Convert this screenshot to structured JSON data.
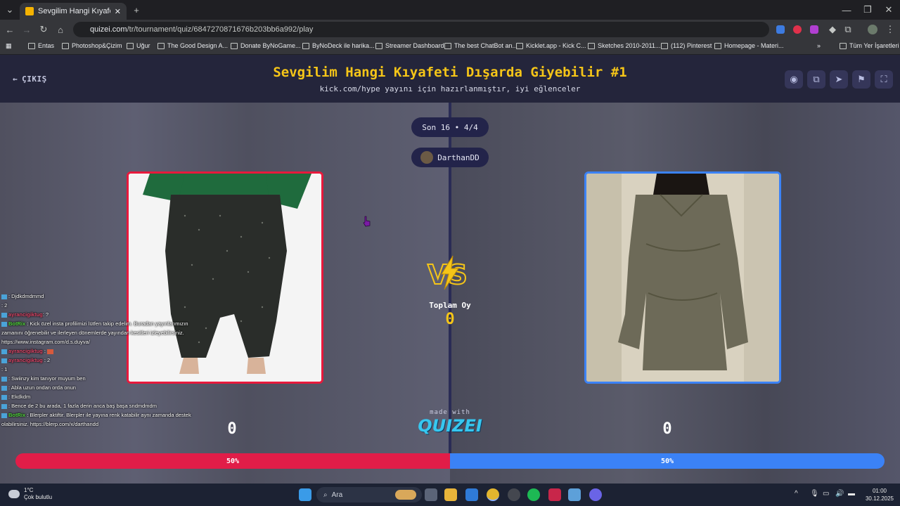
{
  "browser": {
    "tab_title": "Sevgilim Hangi Kıyafeti Dışarda",
    "url_host": "quizei.com",
    "url_path": "/tr/tournament/quiz/6847270871676b203bb6a992/play",
    "bookmarks": [
      "Entas",
      "Photoshop&Çizim",
      "Uğur",
      "The Good Design A...",
      "Donate ByNoGame...",
      "ByNoDeck ile harika...",
      "Streamer Dashboard",
      "The best ChatBot an...",
      "Kicklet.app - Kick C...",
      "Sketches 2010-2011...",
      "(112) Pinterest",
      "Homepage - Materi..."
    ],
    "all_bookmarks": "Tüm Yer İşaretleri",
    "overflow": "»"
  },
  "header": {
    "back_label": "ÇIKIŞ",
    "title": "Sevgilim Hangi Kıyafeti Dışarda Giyebilir #1",
    "subtitle": "kick.com/hype yayını için hazırlanmıştır, iyi eğlenceler"
  },
  "round": {
    "stage": "Son 16 • 4/4",
    "player": "DarthanDD"
  },
  "vs": {
    "total_label": "Toplam Oy",
    "total_value": "0",
    "left_votes": "0",
    "right_votes": "0",
    "left_percent_value": 50,
    "right_percent_value": 50,
    "left_percent": "50%",
    "right_percent": "50%"
  },
  "footer": {
    "made_with": "made with",
    "logo": "QUIZEI"
  },
  "chat": [
    {
      "user": "",
      "msg": ": Djdkdmdmmd"
    },
    {
      "user": "",
      "msg": ": 2"
    },
    {
      "user": "ayrancigiktug",
      "msg": ": ?"
    },
    {
      "user": "BotRix",
      "msg": ": Kick özel insta profilimizi lütfen takip edelim. Buradan yayınlarımızın zamanını öğrenebilir ve ilerleyen dönemlerde yayından kesitleri izleyebilirsiniz. https://www.instagram.com/d.s.duyva/"
    },
    {
      "user": "ayrancigiktug",
      "msg": ":"
    },
    {
      "user": "ayrancigiktug",
      "msg": ": 2"
    },
    {
      "user": "",
      "msg": ": 1"
    },
    {
      "user": "",
      "msg": ": Swiinzy kim tanıyor muyum ben"
    },
    {
      "user": "",
      "msg": ": Abla uzun ondan orda onun"
    },
    {
      "user": "",
      "msg": ": Ekdkdm"
    },
    {
      "user": "",
      "msg": ": Bence de 2 bu arada, 1 fazla derin anca baş başa sndmdmdm"
    },
    {
      "user": "BotRix",
      "msg": ": Blerpler aktiftir. Blerpler ile yayına renk katabilir aynı zamanda destek olabilirsiniz. https://blerp.com/x/darthandd"
    }
  ],
  "taskbar": {
    "temp": "1°C",
    "weather": "Çok bulutlu",
    "search": "Ara",
    "time": "01:00",
    "date": "30.12.2025"
  },
  "colors": {
    "accent_yellow": "#f5c518",
    "left_red": "#e11d48",
    "right_blue": "#3b82f6",
    "header_bg": "#24253b"
  }
}
